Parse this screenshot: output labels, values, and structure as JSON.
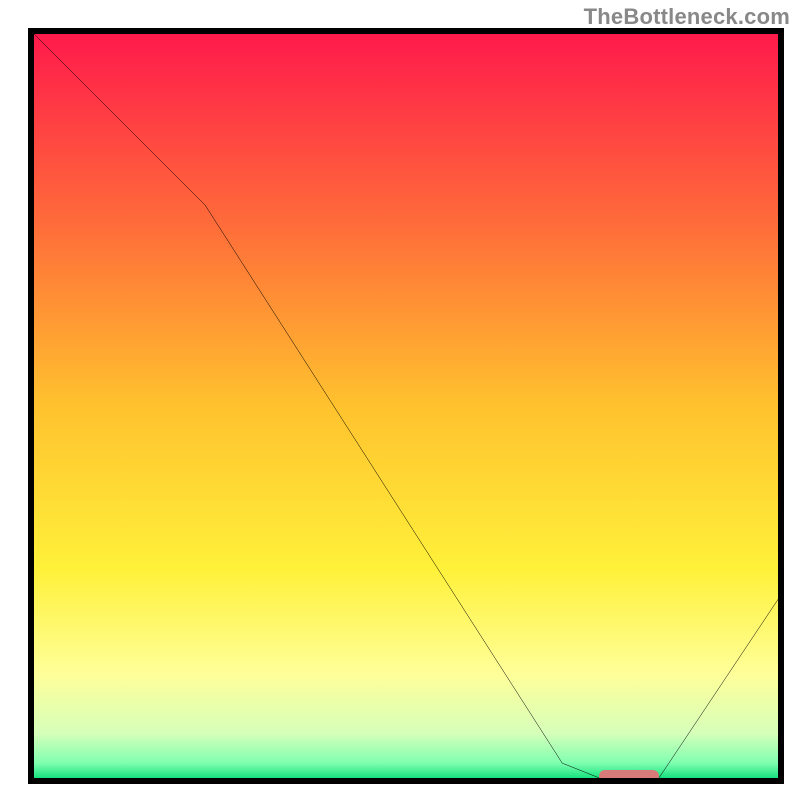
{
  "watermark": "TheBottleneck.com",
  "chart_data": {
    "type": "line",
    "title": "",
    "xlabel": "",
    "ylabel": "",
    "xlim": [
      0,
      100
    ],
    "ylim": [
      0,
      100
    ],
    "x": [
      0,
      23,
      71,
      76,
      84,
      100
    ],
    "values": [
      100,
      77,
      2,
      0,
      0,
      24
    ],
    "optimum_marker": {
      "x_start": 76,
      "x_end": 84,
      "y": 0
    },
    "background": {
      "type": "vertical-gradient",
      "stops": [
        {
          "offset": 0,
          "color": "#ff1a4b"
        },
        {
          "offset": 25,
          "color": "#ff6a3a"
        },
        {
          "offset": 50,
          "color": "#ffc22e"
        },
        {
          "offset": 72,
          "color": "#fff13a"
        },
        {
          "offset": 86,
          "color": "#ffff99"
        },
        {
          "offset": 94,
          "color": "#d6ffba"
        },
        {
          "offset": 98,
          "color": "#7fffb0"
        },
        {
          "offset": 100,
          "color": "#16e07e"
        }
      ]
    }
  }
}
